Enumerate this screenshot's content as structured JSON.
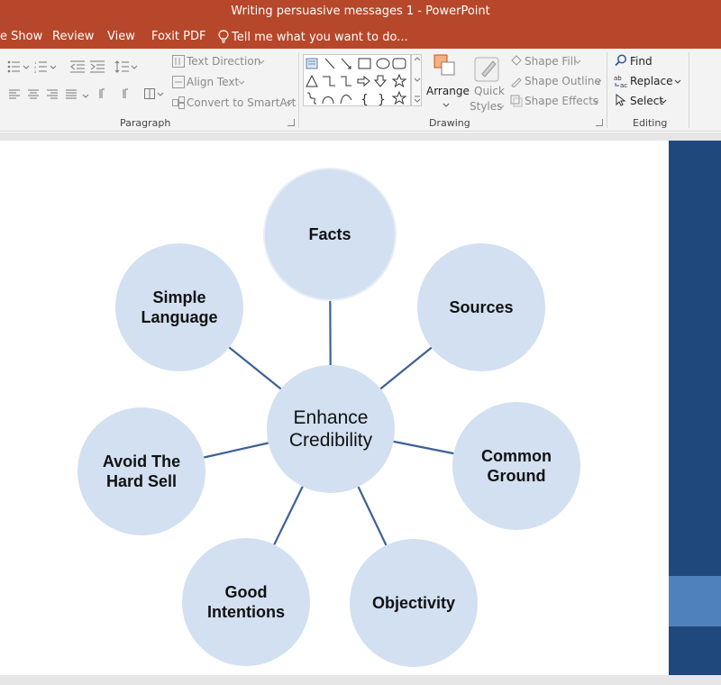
{
  "window": {
    "title": "Writing persuasive messages 1 - PowerPoint"
  },
  "tabs": [
    {
      "label": "e Show"
    },
    {
      "label": "Review"
    },
    {
      "label": "View"
    },
    {
      "label": "Foxit PDF"
    }
  ],
  "tell_me": "Tell me what you want to do...",
  "ribbon": {
    "paragraph": {
      "label": "Paragraph",
      "text_direction": "Text Direction",
      "align_text": "Align Text",
      "convert_smartart": "Convert to SmartArt"
    },
    "drawing": {
      "label": "Drawing",
      "arrange": "Arrange",
      "quick_styles_line1": "Quick",
      "quick_styles_line2": "Styles",
      "shape_fill": "Shape Fill",
      "shape_outline": "Shape Outline",
      "shape_effects": "Shape Effects"
    },
    "editing": {
      "label": "Editing",
      "find": "Find",
      "replace": "Replace",
      "select": "Select"
    }
  },
  "diagram": {
    "center": "Enhance\nCredibility",
    "spokes": [
      {
        "label": "Facts"
      },
      {
        "label": "Sources"
      },
      {
        "label": "Common\nGround"
      },
      {
        "label": "Objectivity"
      },
      {
        "label": "Good\nIntentions"
      },
      {
        "label": "Avoid The\nHard Sell"
      },
      {
        "label": "Simple\nLanguage"
      }
    ],
    "colors": {
      "node_fill": "#d2e0f1",
      "connector": "#3d6193"
    }
  },
  "colors": {
    "titlebar": "#b7472a",
    "ribbon": "#f3f3f3",
    "next_slide": "#1f497d",
    "next_slide_band": "#4f81bd"
  }
}
